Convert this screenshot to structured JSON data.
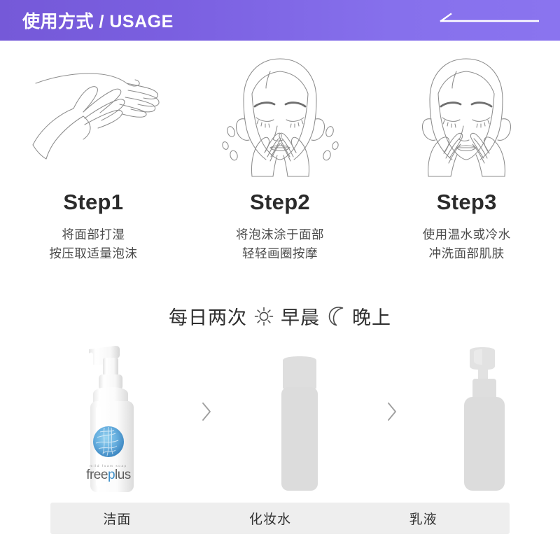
{
  "header": {
    "title": "使用方式 / USAGE",
    "arrow_icon": "long-left-arrow-icon",
    "bg_start": "#7559d8",
    "bg_end": "#8a74ef",
    "text_color": "#ffffff"
  },
  "steps": [
    {
      "art_icon": "two-hands-line-art-icon",
      "title": "Step1",
      "line1": "将面部打湿",
      "line2": "按压取适量泡沫"
    },
    {
      "art_icon": "face-washing-with-foam-icon",
      "title": "Step2",
      "line1": "将泡沫涂于面部",
      "line2": "轻轻画圈按摩"
    },
    {
      "art_icon": "face-rinsing-icon",
      "title": "Step3",
      "line1": "使用温水或冷水",
      "line2": "冲洗面部肌肤"
    }
  ],
  "frequency": {
    "prefix": "每日两次",
    "sun_icon": "sun-icon",
    "morning": "早晨",
    "moon_icon": "moon-icon",
    "night": "晚上"
  },
  "products": [
    {
      "bottle_icon": "freeplus-foam-pump-bottle-icon",
      "brand": "freeplus",
      "tagline": "mild foam soap",
      "logo_icon": "blue-textured-circle-logo-icon",
      "label": "洁面"
    },
    {
      "bottle_icon": "toner-bottle-silhouette-icon",
      "label": "化妆水"
    },
    {
      "bottle_icon": "lotion-pump-bottle-silhouette-icon",
      "label": "乳液"
    }
  ],
  "separators": [
    {
      "icon": "chevron-right-icon"
    },
    {
      "icon": "chevron-right-icon"
    }
  ],
  "colors": {
    "accent_purple": "#7f66e6",
    "label_bar_bg": "#eeeeee",
    "line_art_stroke": "#8a8a8a",
    "bottle_grey": "#dddddd",
    "logo_blue": "#4a9fd8"
  }
}
